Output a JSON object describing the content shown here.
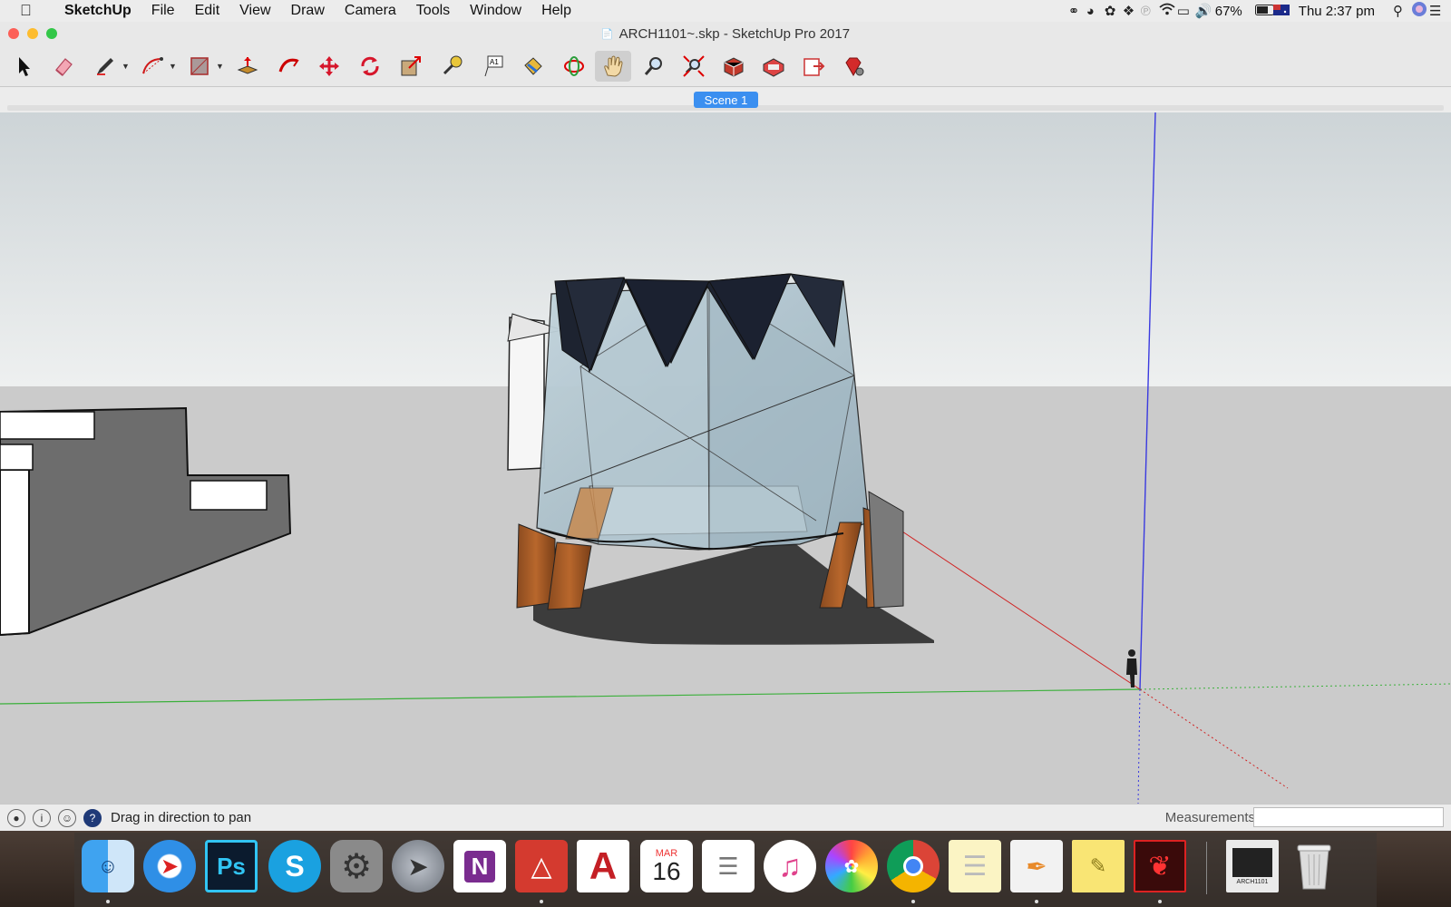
{
  "menubar": {
    "app": "SketchUp",
    "items": [
      "File",
      "Edit",
      "View",
      "Draw",
      "Camera",
      "Tools",
      "Window",
      "Help"
    ],
    "battery": "67%",
    "clock": "Thu 2:37 pm"
  },
  "window": {
    "title": "ARCH1101~.skp - SketchUp Pro 2017"
  },
  "toolbar": {
    "tools": [
      "select",
      "eraser",
      "line",
      "arc",
      "shape",
      "push-pull",
      "follow-me",
      "move",
      "rotate",
      "scale",
      "tape-measure",
      "text",
      "paint-bucket",
      "orbit",
      "pan",
      "zoom",
      "zoom-extents",
      "3d-warehouse",
      "extension-warehouse",
      "send-to-layout",
      "extension-manager"
    ],
    "active": "pan"
  },
  "scenes": {
    "tabs": [
      "Scene 1"
    ]
  },
  "status": {
    "hint": "Drag in direction to pan",
    "measurements_label": "Measurements",
    "measurements_value": ""
  },
  "dock": {
    "apps": [
      "Finder",
      "Safari",
      "Photoshop",
      "Skype",
      "System Preferences",
      "Launchpad",
      "OneNote",
      "SketchUp",
      "AutoCAD",
      "Calendar",
      "Reminders",
      "iTunes",
      "Photos",
      "Chrome",
      "Notes",
      "Pages",
      "Stickies",
      "Acrobat",
      "ARCH1101",
      "Trash"
    ],
    "calendar_month": "MAR",
    "calendar_day": "16",
    "photoshop_label": "Ps",
    "onenote_label": "N",
    "skype_label": "S",
    "autocad_label": "A",
    "folder_label": "ARCH1101",
    "colors": {
      "photoshop": "#0b1b2e",
      "onenote": "#7a2c8f",
      "sketchup": "#d43a2f",
      "autocad": "#c41f25"
    }
  }
}
